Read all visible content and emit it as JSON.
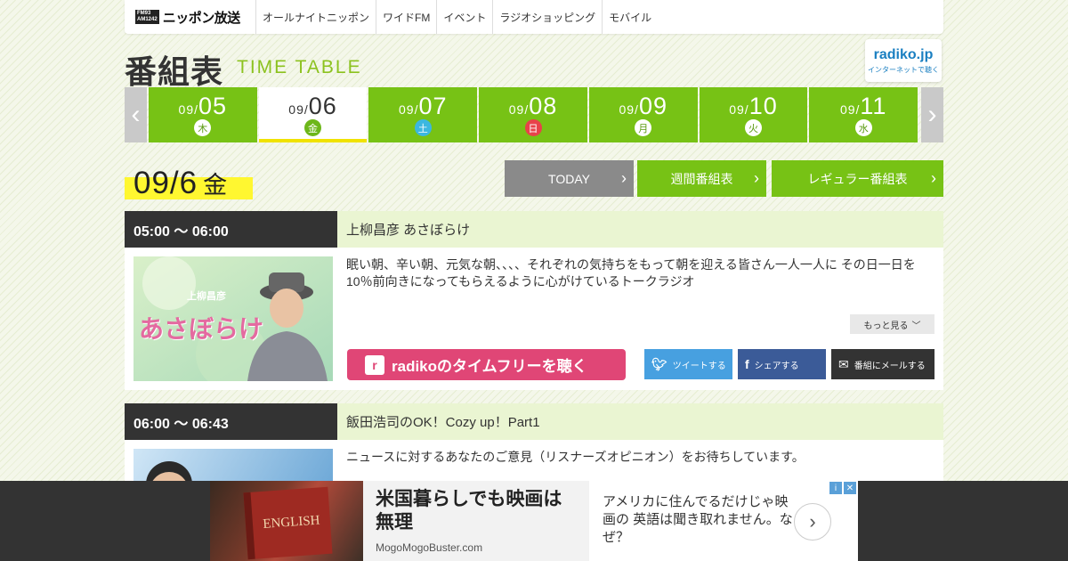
{
  "header": {
    "logo_badge_top": "FM93",
    "logo_badge_bottom": "AM1242",
    "logo_text": "ニッポン放送",
    "nav": [
      "オールナイトニッポン",
      "ワイドFM",
      "イベント",
      "ラジオショッピング",
      "モバイル"
    ]
  },
  "title": {
    "jp": "番組表",
    "en": "TIME TABLE"
  },
  "radiko": {
    "logo": "radiko.jp",
    "sub": "インターネットで聴く"
  },
  "dates": [
    {
      "prefix": "09/",
      "day": "05",
      "dow": "木"
    },
    {
      "prefix": "09/",
      "day": "06",
      "dow": "金"
    },
    {
      "prefix": "09/",
      "day": "07",
      "dow": "土"
    },
    {
      "prefix": "09/",
      "day": "08",
      "dow": "日"
    },
    {
      "prefix": "09/",
      "day": "09",
      "dow": "月"
    },
    {
      "prefix": "09/",
      "day": "10",
      "dow": "火"
    },
    {
      "prefix": "09/",
      "day": "11",
      "dow": "水"
    }
  ],
  "current": {
    "date": "09/6",
    "dow": "金"
  },
  "buttons": {
    "today": "TODAY",
    "week": "週間番組表",
    "regular": "レギュラー番組表"
  },
  "programs": [
    {
      "time": "05:00 ～ 06:00",
      "title": "上柳昌彦 あさぼらけ",
      "desc": "眠い朝、辛い朝、元気な朝、、、、それぞれの気持ちをもって朝を迎える皆さん一人一人に その日一日を10％前向きになってもらえるように心がけているトークラジオ",
      "image_label": "上柳昌彦",
      "image_title": "あさぼらけ",
      "more": "もっと見る",
      "radiko_btn": "radikoのタイムフリーを聴く",
      "tweet": "ツイートする",
      "share": "シェアする",
      "mail": "番組にメールする"
    },
    {
      "time": "06:00 ～ 06:43",
      "title": "飯田浩司のOK！Cozy up！Part1",
      "desc": "ニュースに対するあなたのご意見（リスナーズオピニオン）をお待ちしています。"
    }
  ],
  "ad": {
    "book_text": "ENGLISH",
    "headline": "米国暮らしでも映画は無理",
    "source": "MogoMogoBuster.com",
    "body": "アメリカに住んでるだけじゃ映画の 英語は聞き取れません。なぜ？",
    "go": "›"
  },
  "colors": {
    "accent_green": "#77c215",
    "highlight_yellow": "#fff730",
    "radiko_pink": "#e04676"
  }
}
